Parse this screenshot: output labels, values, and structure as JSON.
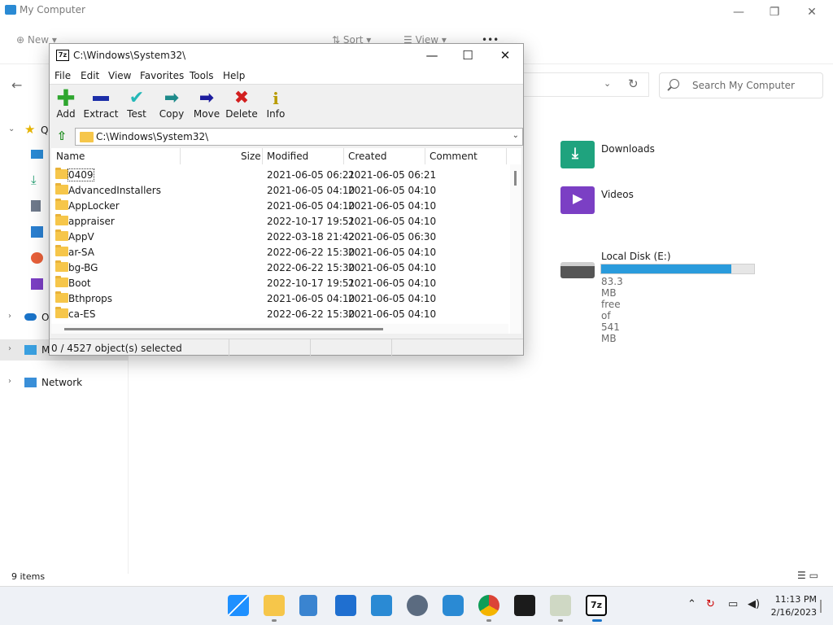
{
  "explorer": {
    "title": "My Computer",
    "window_controls": {
      "minimize": "—",
      "maximize": "❐",
      "close": "✕"
    },
    "toolbar": {
      "new": "New",
      "sort": "Sort",
      "view": "View",
      "more": "•••"
    },
    "search": {
      "placeholder": "Search My Computer"
    },
    "sidebar": {
      "quick_access": "Q",
      "onedrive": "O",
      "this_pc": "M",
      "network": "Network"
    },
    "tiles": {
      "downloads": "Downloads",
      "videos": "Videos",
      "disk_name": "Local Disk (E:)",
      "disk_free": "83.3 MB free of 541 MB",
      "disk_used_fraction": 0.85
    },
    "status": "9 items"
  },
  "sevenzip": {
    "title": "C:\\Windows\\System32\\",
    "logo": "7z",
    "controls": {
      "minimize": "—",
      "maximize": "☐",
      "close": "✕"
    },
    "menu": [
      "File",
      "Edit",
      "View",
      "Favorites",
      "Tools",
      "Help"
    ],
    "tools": [
      {
        "label": "Add",
        "icon": "plus-icon",
        "color": "#2fa62f"
      },
      {
        "label": "Extract",
        "icon": "minus-icon",
        "color": "#1c2ea8"
      },
      {
        "label": "Test",
        "icon": "check-icon",
        "color": "#25b8b8"
      },
      {
        "label": "Copy",
        "icon": "arrow-right-icon",
        "color": "#1e8a8a"
      },
      {
        "label": "Move",
        "icon": "arrow-right-icon",
        "color": "#1c1c9e"
      },
      {
        "label": "Delete",
        "icon": "x-icon",
        "color": "#d21f1f"
      },
      {
        "label": "Info",
        "icon": "info-icon",
        "color": "#b89a00"
      }
    ],
    "path": "C:\\Windows\\System32\\",
    "columns": {
      "name": "Name",
      "size": "Size",
      "modified": "Modified",
      "created": "Created",
      "comment": "Comment"
    },
    "rows": [
      {
        "name": "0409",
        "modified": "2021-06-05 06:21",
        "created": "2021-06-05 06:21"
      },
      {
        "name": "AdvancedInstallers",
        "modified": "2021-06-05 04:10",
        "created": "2021-06-05 04:10"
      },
      {
        "name": "AppLocker",
        "modified": "2021-06-05 04:10",
        "created": "2021-06-05 04:10"
      },
      {
        "name": "appraiser",
        "modified": "2022-10-17 19:51",
        "created": "2021-06-05 04:10"
      },
      {
        "name": "AppV",
        "modified": "2022-03-18 21:42",
        "created": "2021-06-05 06:30"
      },
      {
        "name": "ar-SA",
        "modified": "2022-06-22 15:30",
        "created": "2021-06-05 04:10"
      },
      {
        "name": "bg-BG",
        "modified": "2022-06-22 15:30",
        "created": "2021-06-05 04:10"
      },
      {
        "name": "Boot",
        "modified": "2022-10-17 19:51",
        "created": "2021-06-05 04:10"
      },
      {
        "name": "Bthprops",
        "modified": "2021-06-05 04:10",
        "created": "2021-06-05 04:10"
      },
      {
        "name": "ca-ES",
        "modified": "2022-06-22 15:30",
        "created": "2021-06-05 04:10"
      }
    ],
    "status": "0 / 4527 object(s) selected"
  },
  "taskbar": {
    "apps": [
      "start-icon",
      "file-explorer-icon",
      "notepad-icon",
      "store-icon",
      "photos-icon",
      "settings-icon",
      "network-app-icon",
      "chrome-icon",
      "terminal-icon",
      "control-panel-icon",
      "sevenzip-icon"
    ],
    "time": "11:13 PM",
    "date": "2/16/2023"
  }
}
